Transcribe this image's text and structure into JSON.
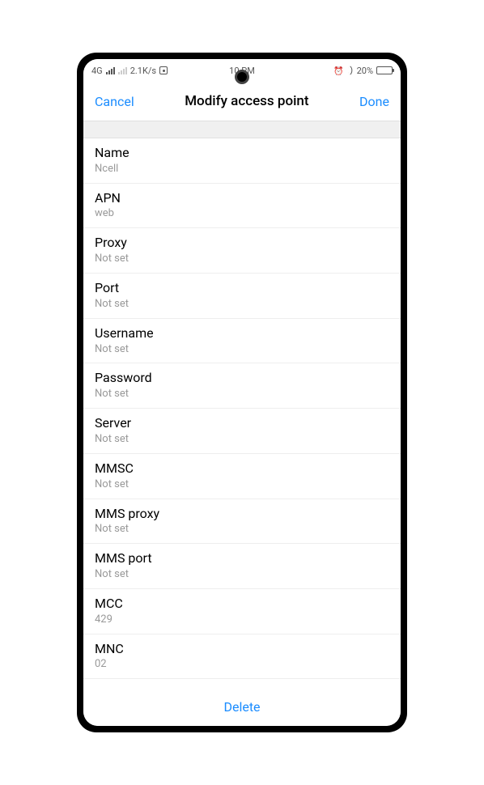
{
  "status": {
    "network": "4G",
    "speed": "2.1K/s",
    "time": "10     PM",
    "battery_pct": "20%"
  },
  "nav": {
    "cancel": "Cancel",
    "title": "Modify access point",
    "done": "Done"
  },
  "fields": [
    {
      "label": "Name",
      "value": "Ncell"
    },
    {
      "label": "APN",
      "value": "web"
    },
    {
      "label": "Proxy",
      "value": "Not set"
    },
    {
      "label": "Port",
      "value": "Not set"
    },
    {
      "label": "Username",
      "value": "Not set"
    },
    {
      "label": "Password",
      "value": "Not set"
    },
    {
      "label": "Server",
      "value": "Not set"
    },
    {
      "label": "MMSC",
      "value": "Not set"
    },
    {
      "label": "MMS proxy",
      "value": "Not set"
    },
    {
      "label": "MMS port",
      "value": "Not set"
    },
    {
      "label": "MCC",
      "value": "429"
    },
    {
      "label": "MNC",
      "value": "02"
    }
  ],
  "footer": {
    "delete": "Delete"
  }
}
